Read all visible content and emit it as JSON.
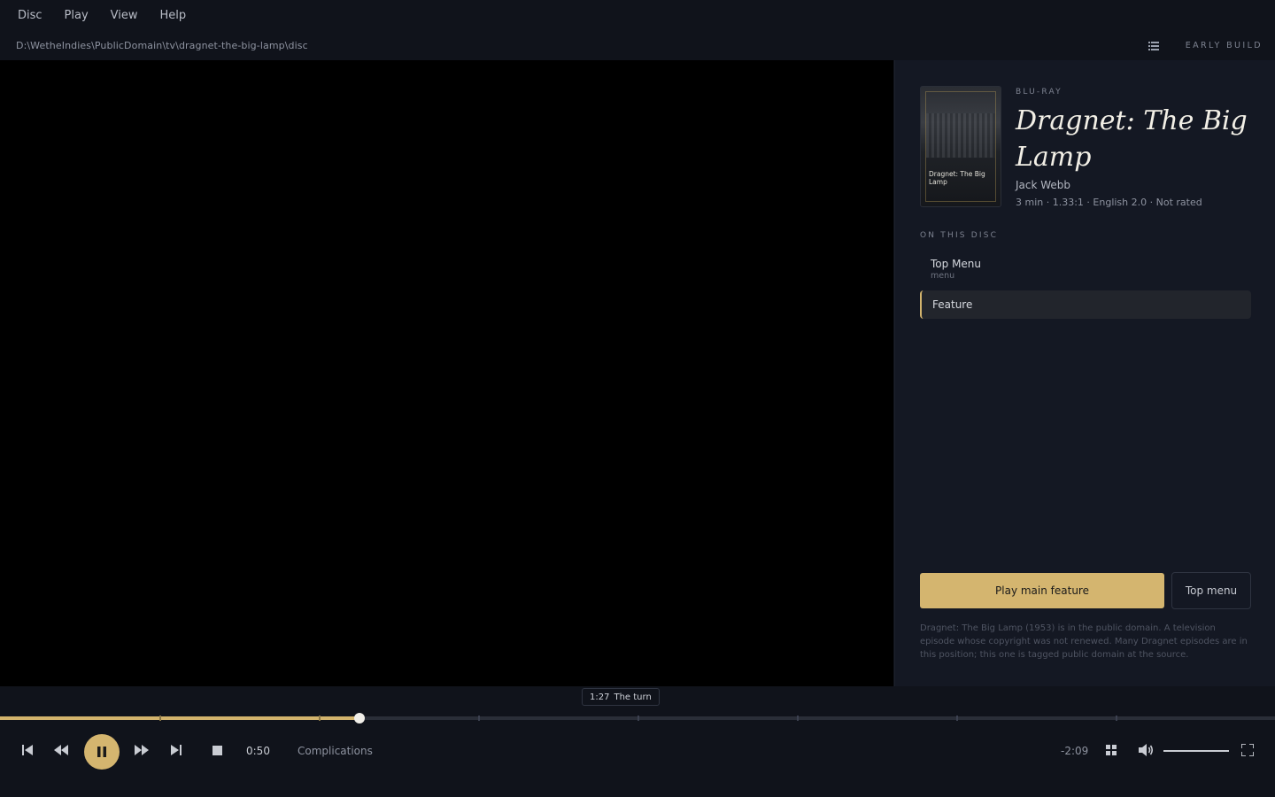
{
  "menu": {
    "items": [
      {
        "label": "Disc"
      },
      {
        "label": "Play"
      },
      {
        "label": "View"
      },
      {
        "label": "Help"
      }
    ]
  },
  "path": "D:\\WetheIndies\\PublicDomain\\tv\\dragnet-the-big-lamp\\disc",
  "build_label": "EARLY BUILD",
  "disc": {
    "cover_title": "Dragnet: The Big Lamp",
    "kind": "BLU-RAY",
    "title": "Dragnet: The Big Lamp",
    "director": "Jack Webb",
    "meta": "3 min · 1.33:1 · English 2.0 · Not rated",
    "section_label": "ON THIS DISC",
    "items": [
      {
        "name": "Top Menu",
        "sub": "menu"
      },
      {
        "name": "Feature",
        "sub": ""
      }
    ],
    "play_button": "Play main feature",
    "top_menu_button": "Top menu",
    "note": "Dragnet: The Big Lamp (1953) is in the public domain. A television episode whose copyright was not renewed. Many Dragnet episodes are in this position; this one is tagged public domain at the source."
  },
  "player": {
    "tooltip_time": "1:27",
    "tooltip_label": "The turn",
    "progress": 0.2819,
    "chapter_ticks": [
      0.125,
      0.25,
      0.375,
      0.5,
      0.625,
      0.75,
      0.875
    ],
    "elapsed": "0:50",
    "chapter": "Complications",
    "remaining": "-2:09",
    "volume": 1.0,
    "accent_color": "#d4b56f"
  }
}
